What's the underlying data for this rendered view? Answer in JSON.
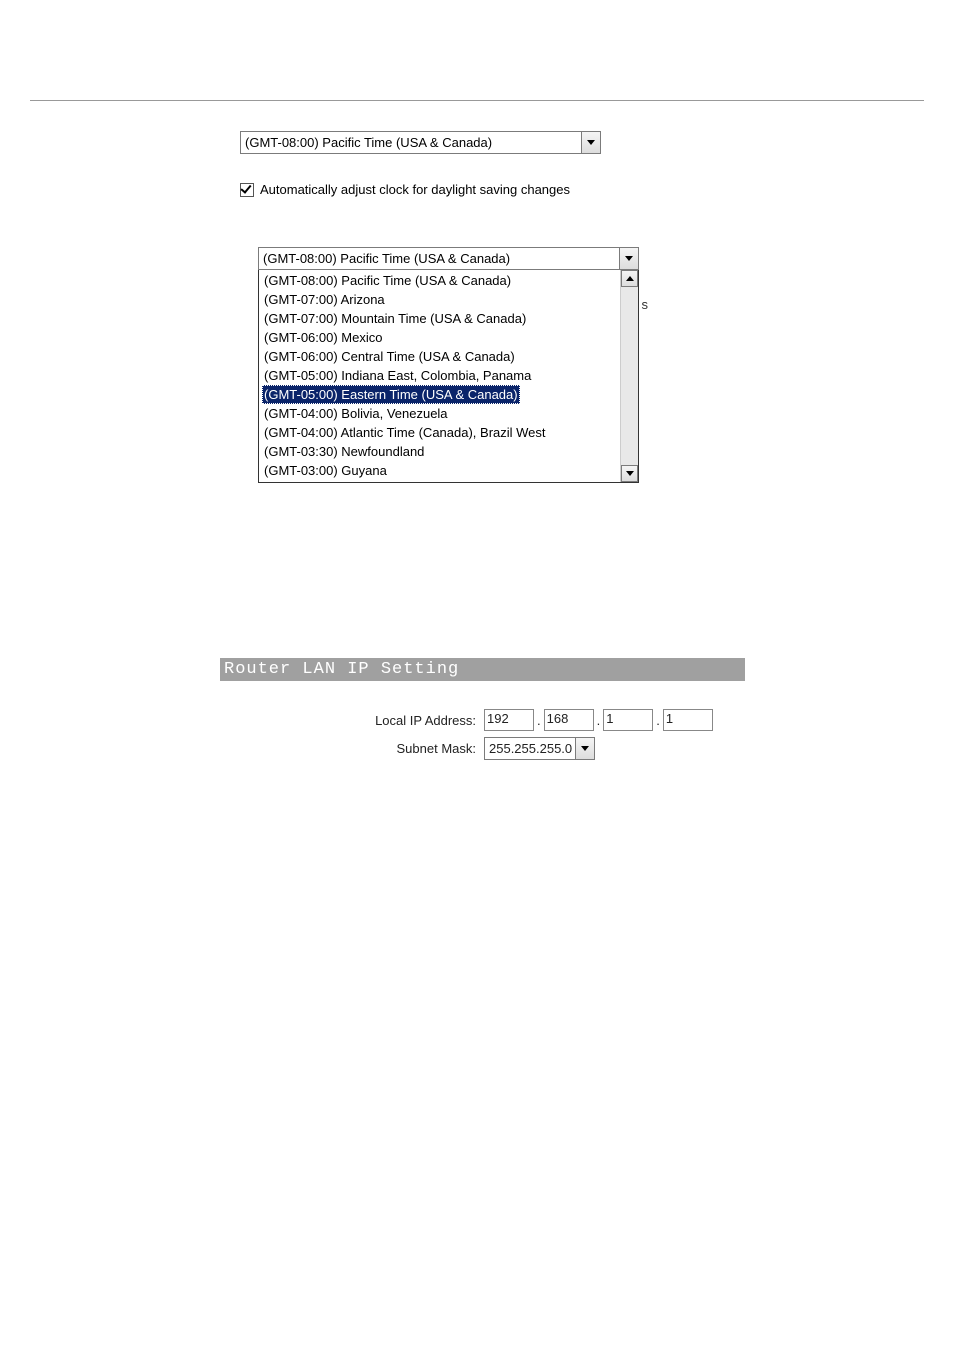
{
  "timezone": {
    "selected": "(GMT-08:00) Pacific Time (USA & Canada)",
    "dst_label": "Automatically adjust clock for daylight saving changes",
    "dropdown_selected": "(GMT-08:00) Pacific Time (USA & Canada)",
    "options": [
      "(GMT-08:00) Pacific Time (USA & Canada)",
      "(GMT-07:00) Arizona",
      "(GMT-07:00) Mountain Time (USA & Canada)",
      "(GMT-06:00) Mexico",
      "(GMT-06:00) Central Time (USA & Canada)",
      "(GMT-05:00) Indiana East, Colombia, Panama",
      "(GMT-05:00) Eastern Time (USA & Canada)",
      "(GMT-04:00) Bolivia, Venezuela",
      "(GMT-04:00) Atlantic Time (Canada), Brazil West",
      "(GMT-03:30) Newfoundland",
      "(GMT-03:00) Guyana"
    ],
    "highlighted_index": 6,
    "stray_char": "s"
  },
  "lan": {
    "title": "Router LAN IP Setting",
    "ip_label": "Local IP Address:",
    "subnet_label": "Subnet Mask:",
    "ip": [
      "192",
      "168",
      "1",
      "1"
    ],
    "subnet": "255.255.255.0"
  }
}
